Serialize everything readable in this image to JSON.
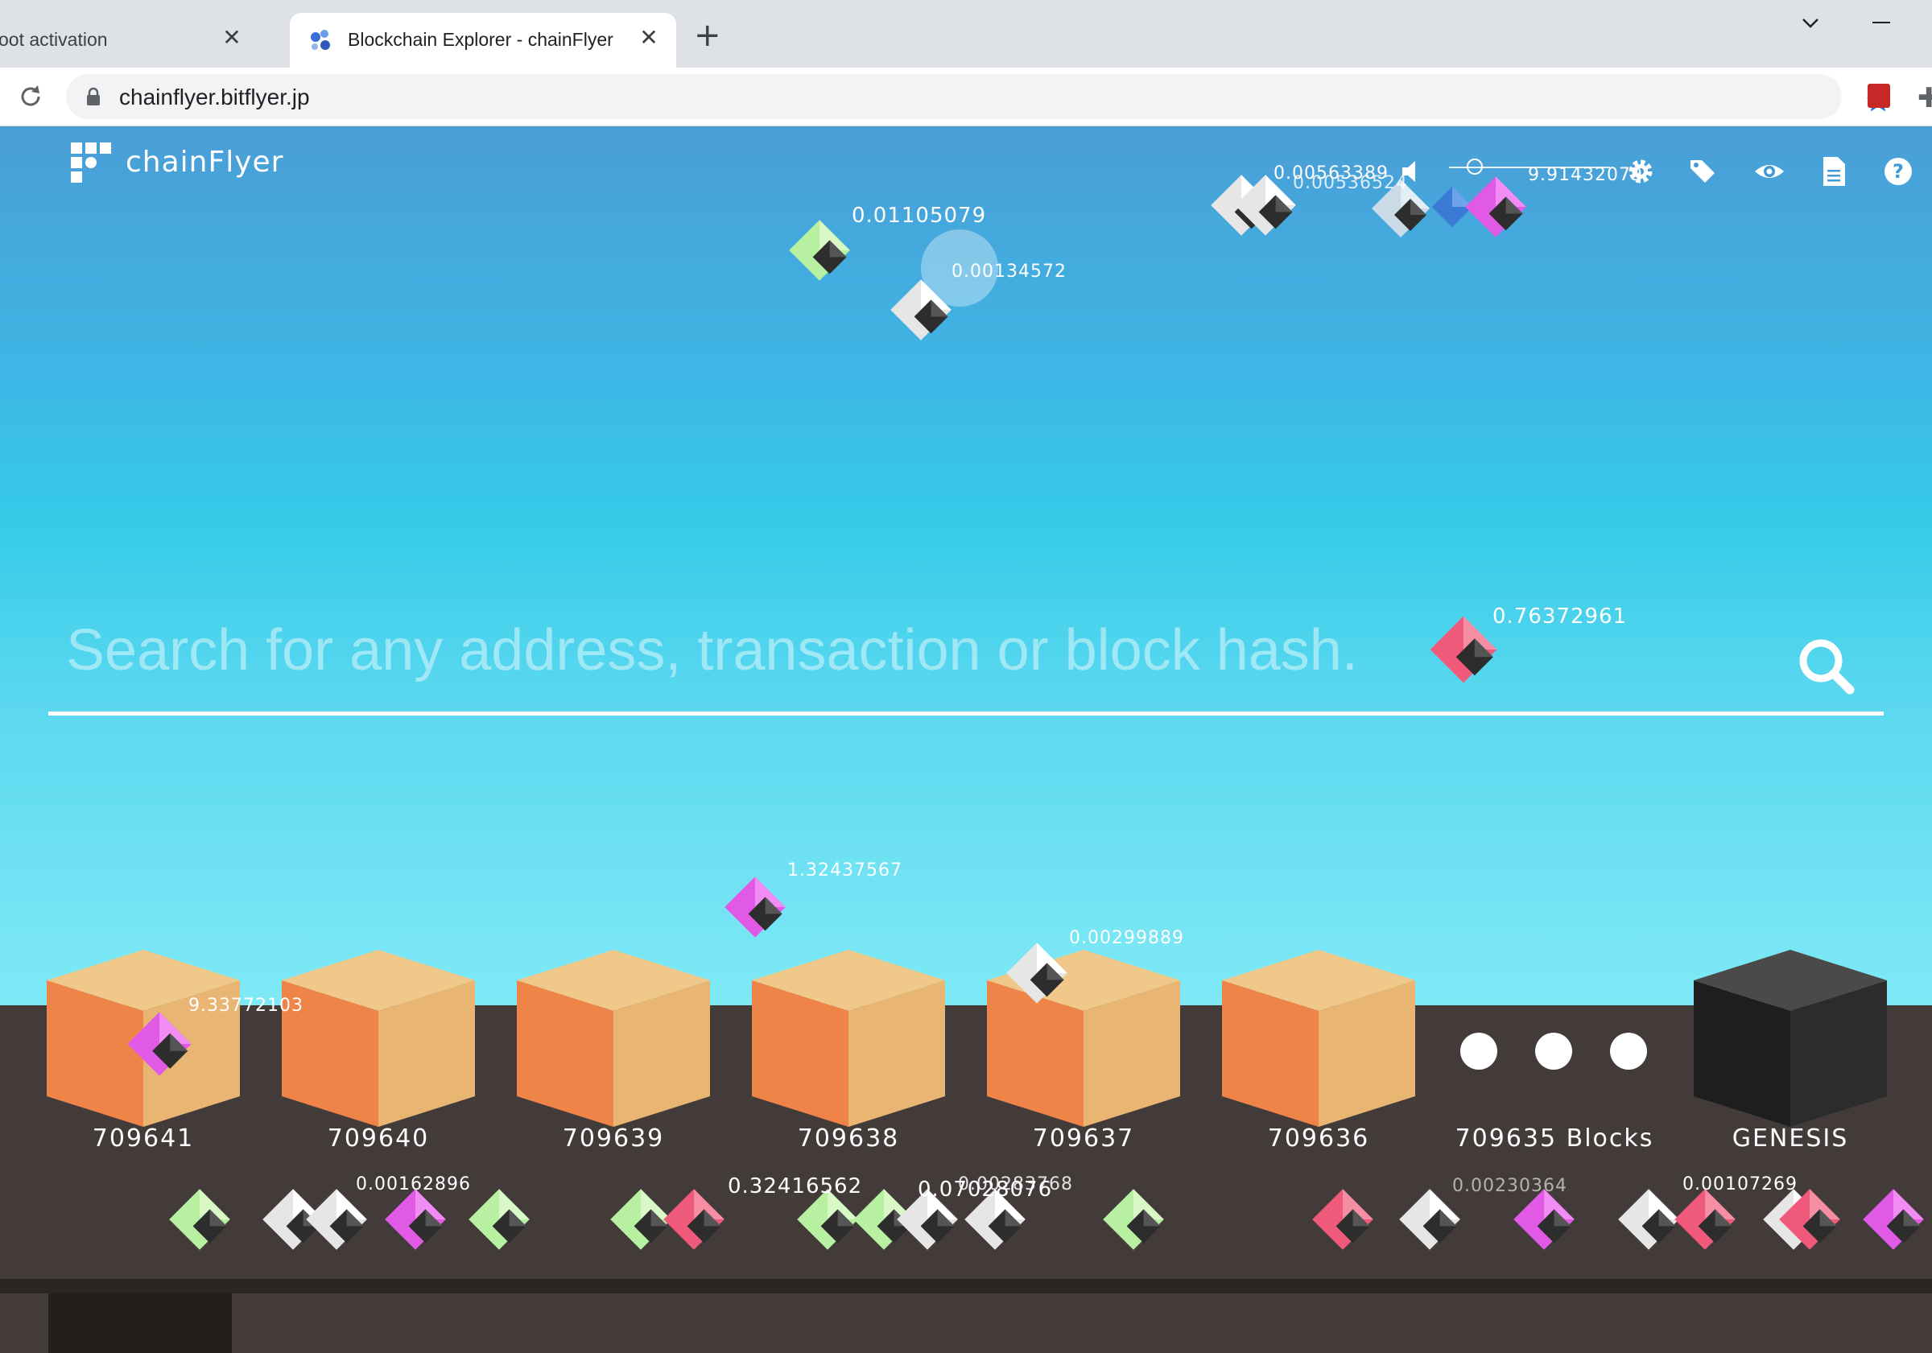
{
  "browser": {
    "tabs": [
      {
        "title": "oot activation",
        "close": "✕",
        "active": false
      },
      {
        "title": "Blockchain Explorer - chainFlyer",
        "close": "✕",
        "active": true
      }
    ],
    "new_tab": "+",
    "url": "chainflyer.bitflyer.jp",
    "icons": {
      "reload": "reload-icon",
      "lock": "lock-icon",
      "bookmark": "star-icon",
      "extensions": "puzzle-icon"
    }
  },
  "app": {
    "brand": "chainFlyer",
    "header_icons": [
      "volume-icon",
      "settings-gear-icon",
      "tags-icon",
      "eye-icon",
      "document-icon",
      "help-icon"
    ],
    "search": {
      "placeholder": "Search for any address, transaction or block hash."
    },
    "blocks": [
      {
        "label": "709641"
      },
      {
        "label": "709640"
      },
      {
        "label": "709639"
      },
      {
        "label": "709638"
      },
      {
        "label": "709637"
      },
      {
        "label": "709636"
      }
    ],
    "blocks_summary": "709635 Blocks",
    "genesis_label": "GENESIS",
    "transactions": [
      {
        "value": "0.01105079"
      },
      {
        "value": "0.00134572"
      },
      {
        "value": "0.00563389"
      },
      {
        "value": "0.00536524"
      },
      {
        "value": "9.91432079"
      },
      {
        "value": "0.76372961"
      },
      {
        "value": "1.32437567"
      },
      {
        "value": "0.00299889"
      },
      {
        "value": "9.33772103"
      },
      {
        "value": "0.00162896"
      },
      {
        "value": "0.32416562"
      },
      {
        "value": "0.07028076"
      },
      {
        "value": "0.00283768"
      },
      {
        "value": "0.00230364"
      },
      {
        "value": "0.00107269"
      }
    ],
    "colors": {
      "sky_top": "#4a9ed6",
      "sky_bottom": "#7fe9f6",
      "ground": "#433b3a",
      "block_left": "#ef8449",
      "block_right": "#e8b572",
      "block_top": "#f0c98a",
      "genesis": "#2a2a2a",
      "crystal_green": "#b6f0a0",
      "crystal_white": "#e6e6e6",
      "crystal_pink": "#f05a7a",
      "crystal_magenta": "#e15ae6",
      "crystal_blue": "#3a7bd5"
    }
  }
}
